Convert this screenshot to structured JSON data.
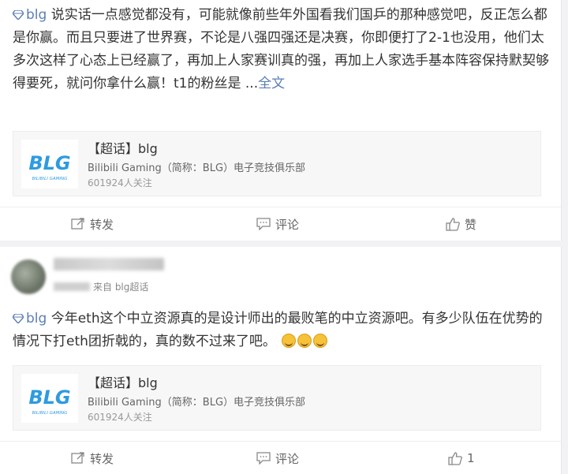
{
  "posts": [
    {
      "topic_tag": "blg",
      "text": "说实话一点感觉都没有，可能就像前些年外国看我们国乒的那种感觉吧，反正怎么都是你赢。而且只要进了世界赛，不论是八强四强还是决赛，你即便打了2-1也没用，他们太多次这样了心态上已经赢了，再加上人家赛训真的强，再加上人家选手基本阵容保持默契够得要死，就问你拿什么赢！t1的粉丝是 ...",
      "more_label": "全文",
      "topic_card": {
        "title": "【超话】blg",
        "subtitle": "Bilibili Gaming（简称：BLG）电子竞技俱乐部",
        "followers": "601924人关注",
        "logo_text": "BLG",
        "logo_subtext": "BILIBILI GAMING"
      },
      "actions": {
        "repost": "转发",
        "comment": "评论",
        "like": "赞"
      }
    },
    {
      "meta_source": "来自 blg超话",
      "topic_tag": "blg",
      "text": "今年eth这个中立资源真的是设计师出的最败笔的中立资源吧。有多少队伍在优势的情况下打eth团折戟的，真的数不过来了吧。",
      "topic_card": {
        "title": "【超话】blg",
        "subtitle": "Bilibili Gaming（简称：BLG）电子竞技俱乐部",
        "followers": "601924人关注",
        "logo_text": "BLG",
        "logo_subtext": "BILIBILI GAMING"
      },
      "actions": {
        "repost": "转发",
        "comment": "评论",
        "like": "1"
      }
    }
  ],
  "colors": {
    "link": "#5b7fb4",
    "logo": "#2e9be0",
    "text": "#333333"
  },
  "icons": [
    "diamond-icon",
    "repost-icon",
    "comment-icon",
    "like-icon",
    "laugh-cry-emoji-icon"
  ]
}
